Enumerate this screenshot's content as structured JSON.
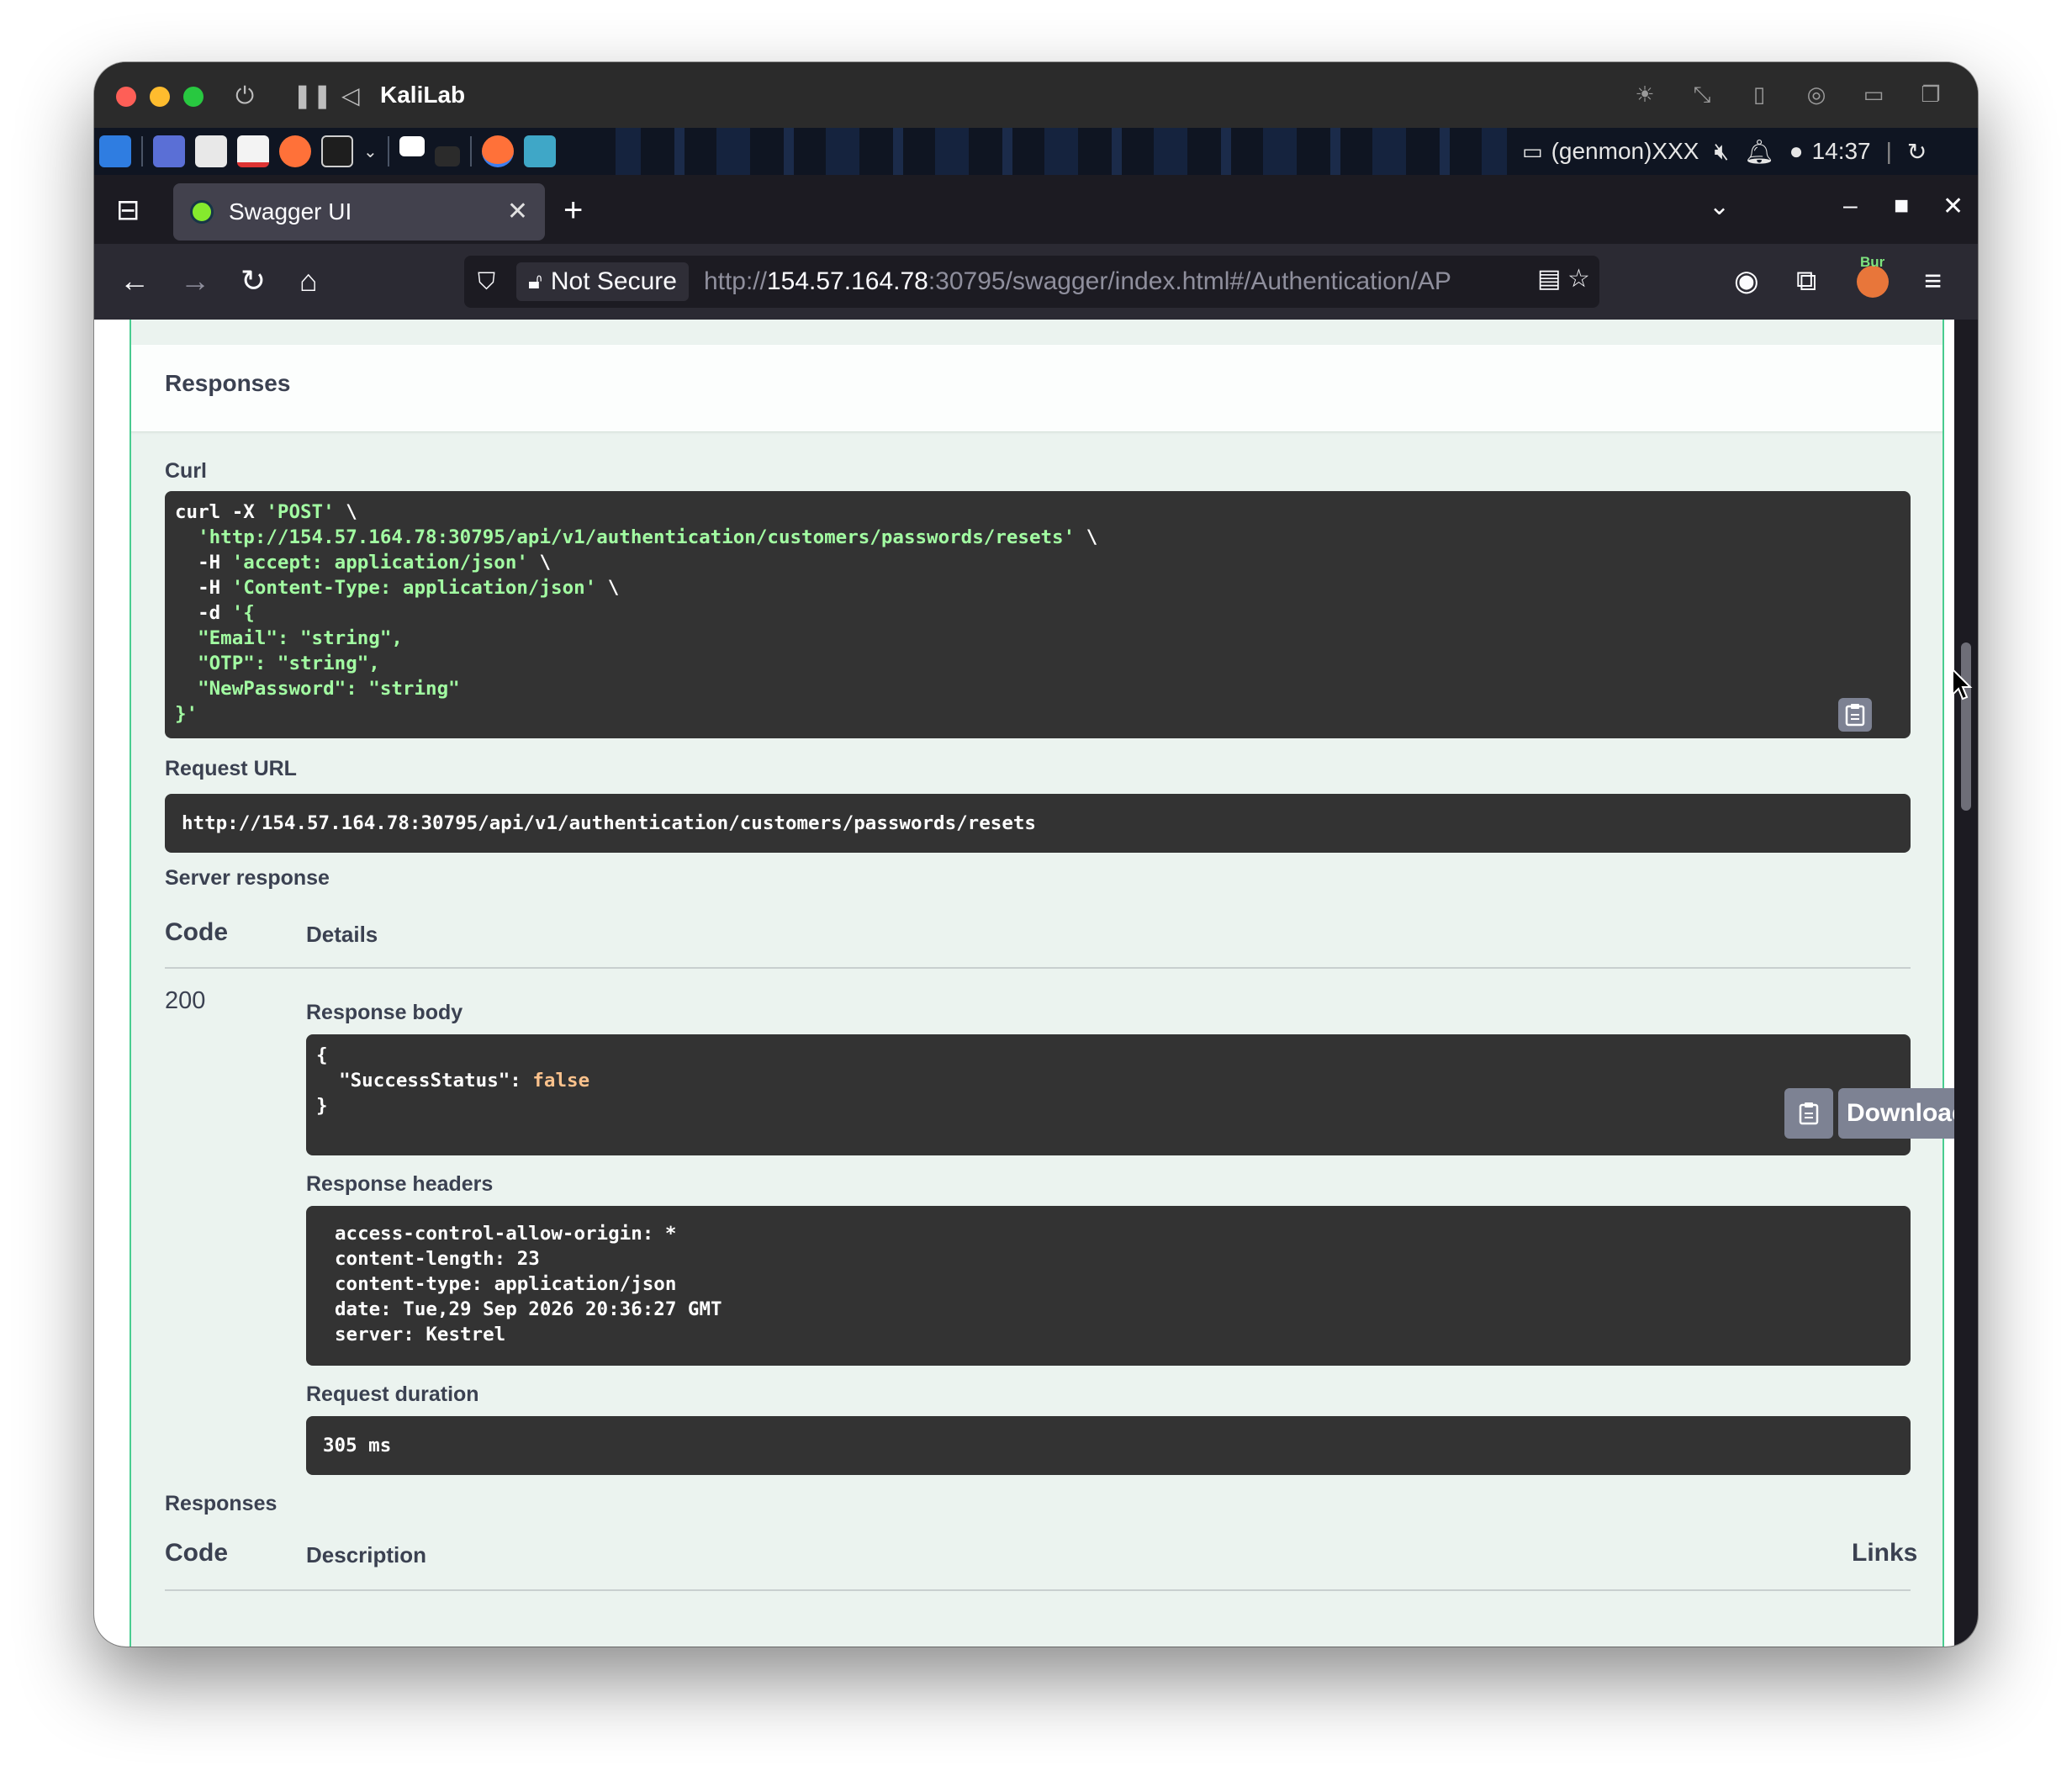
{
  "vm": {
    "title": "KaliLab"
  },
  "panel": {
    "genmon": "(genmon)XXX",
    "clock": "14:37",
    "burp_badge": "Bur"
  },
  "browser": {
    "tab_title": "Swagger UI",
    "url_security": "Not Secure",
    "url_prefix": "http://",
    "url_host": "154.57.164.78",
    "url_rest": ":30795/swagger/index.html#/Authentication/AP"
  },
  "page": {
    "responses_heading": "Responses",
    "curl_label": "Curl",
    "curl_lines": [
      {
        "a": "curl -X ",
        "s": "'POST'",
        "b": " \\"
      },
      {
        "a": "  ",
        "s": "'http://154.57.164.78:30795/api/v1/authentication/customers/passwords/resets'",
        "b": " \\"
      },
      {
        "a": "  -H ",
        "s": "'accept: application/json'",
        "b": " \\"
      },
      {
        "a": "  -H ",
        "s": "'Content-Type: application/json'",
        "b": " \\"
      },
      {
        "a": "  -d ",
        "s": "'{",
        "b": ""
      },
      {
        "a": "  ",
        "s": "\"Email\": \"string\",",
        "b": ""
      },
      {
        "a": "  ",
        "s": "\"OTP\": \"string\",",
        "b": ""
      },
      {
        "a": "  ",
        "s": "\"NewPassword\": \"string\"",
        "b": ""
      },
      {
        "a": "",
        "s": "}'",
        "b": ""
      }
    ],
    "request_url_label": "Request URL",
    "request_url": "http://154.57.164.78:30795/api/v1/authentication/customers/passwords/resets",
    "server_response_label": "Server response",
    "col_code": "Code",
    "col_details": "Details",
    "status_code": "200",
    "response_body_label": "Response body",
    "response_body": {
      "open": "{",
      "key": "  \"SuccessStatus\": ",
      "value": "false",
      "close": "}"
    },
    "download_label": "Download",
    "response_headers_label": "Response headers",
    "response_headers": [
      "access-control-allow-origin: *",
      "content-length: 23",
      "content-type: application/json",
      "date: Tue,29 Sep 2026 20:36:27 GMT",
      "server: Kestrel"
    ],
    "request_duration_label": "Request duration",
    "request_duration": "305 ms",
    "responses_label": "Responses",
    "col_code2": "Code",
    "col_description": "Description",
    "col_links": "Links"
  }
}
